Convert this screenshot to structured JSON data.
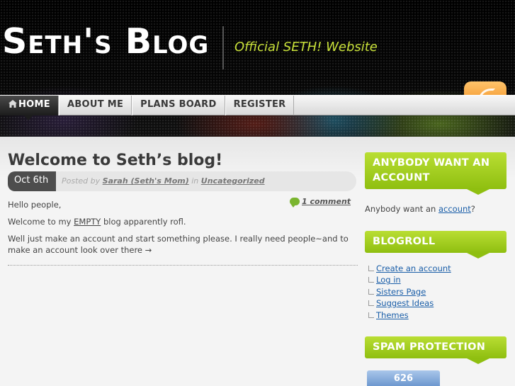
{
  "header": {
    "site_title": "Seth's Blog",
    "tagline": "Official SETH! Website",
    "feed_icon": "rss-icon"
  },
  "nav": {
    "items": [
      {
        "label": "HOME",
        "active": true,
        "icon": "home-icon"
      },
      {
        "label": "ABOUT ME"
      },
      {
        "label": "PLANS BOARD"
      },
      {
        "label": "REGISTER"
      }
    ]
  },
  "post": {
    "title": "Welcome to Seth’s blog!",
    "date": "Oct 6th",
    "posted_by_prefix": "Posted by",
    "author": "Sarah (Seth's Mom)",
    "in_word": "in",
    "category": "Uncategorized",
    "comments": "1 comment",
    "paragraph_1": "Hello people,",
    "paragraph_2_prefix": "Welcome to my",
    "paragraph_2_emphasis": "EMPTY",
    "paragraph_2_suffix": "blog apparently rofl.",
    "paragraph_3": "Well just make an account and start something please. I really need people~and to make an account look over there →"
  },
  "sidebar": {
    "account_widget": {
      "heading": "ANYBODY WANT AN ACCOUNT",
      "text_prefix": "Anybody want an",
      "link": "account",
      "text_suffix": "?"
    },
    "blogroll": {
      "heading": "BLOGROLL",
      "links": [
        "Create an account",
        "Log in",
        "Sisters Page",
        "Suggest Ideas",
        "Themes"
      ]
    },
    "spam_widget": {
      "heading": "SPAM PROTECTION",
      "counter": "626"
    }
  },
  "colors": {
    "accent_green": "#a2cd1f",
    "tagline_color": "#c8e03a",
    "link_blue": "#1a5ea8",
    "feed_orange": "#f08a1c"
  }
}
